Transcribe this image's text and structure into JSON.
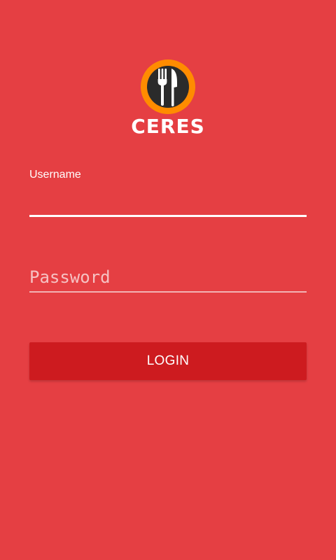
{
  "app": {
    "logo_text": "CERES",
    "logo_icon": "fork-and-knife-icon"
  },
  "form": {
    "username": {
      "label": "Username",
      "value": "",
      "placeholder": ""
    },
    "password": {
      "value": "",
      "placeholder": "Password"
    },
    "login_label": "LOGIN"
  },
  "colors": {
    "background": "#e53f43",
    "button": "#cd1b1f",
    "logo_ring": "#ff8c00",
    "logo_inner": "#2b2b2b",
    "text": "#ffffff"
  }
}
